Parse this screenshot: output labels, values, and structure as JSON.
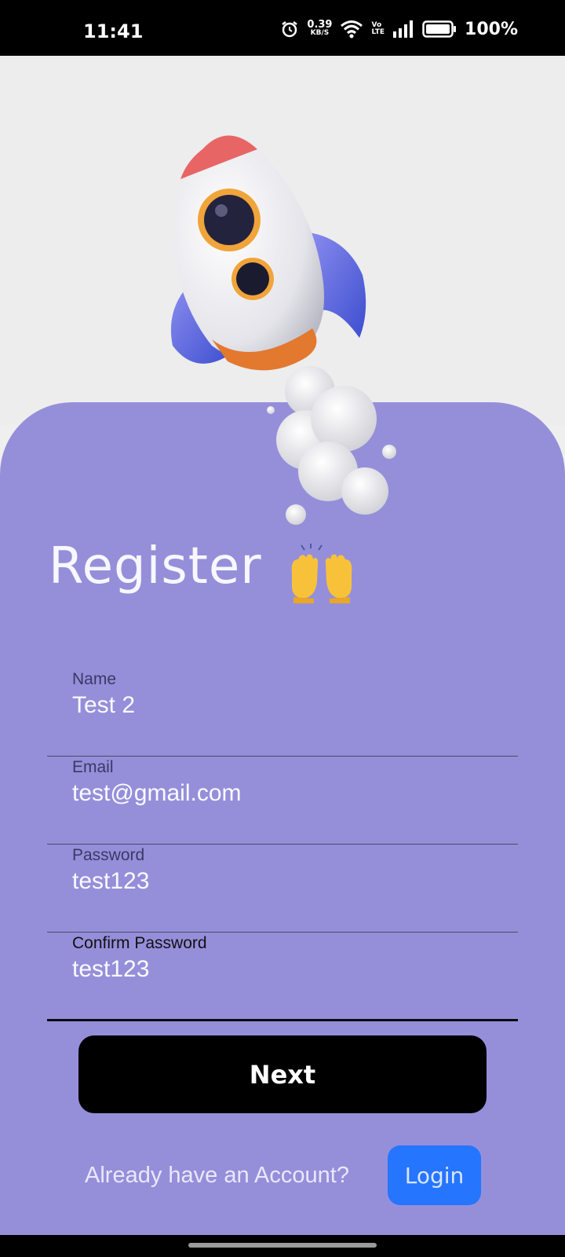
{
  "status_bar": {
    "time": "11:41",
    "net_speed_value": "0.39",
    "net_speed_unit": "KB/S",
    "volte_top": "Vo",
    "volte_bottom": "LTE",
    "battery_percent": "100%",
    "icons": [
      "alarm-icon",
      "wifi-icon",
      "signal-icon",
      "battery-icon"
    ]
  },
  "hero": {
    "image": "rocket-illustration"
  },
  "title": "Register",
  "title_emoji": "raising-hands-emoji",
  "form": {
    "fields": [
      {
        "label": "Name",
        "value": "Test 2"
      },
      {
        "label": "Email",
        "value": "test@gmail.com"
      },
      {
        "label": "Password",
        "value": "test123"
      },
      {
        "label": "Confirm Password",
        "value": "test123"
      }
    ]
  },
  "next_button": "Next",
  "footer": {
    "prompt": "Already have an Account?",
    "login_label": "Login"
  },
  "colors": {
    "card": "#958fda",
    "login_button": "#2575ff",
    "next_button": "#000000",
    "background": "#efefef"
  }
}
